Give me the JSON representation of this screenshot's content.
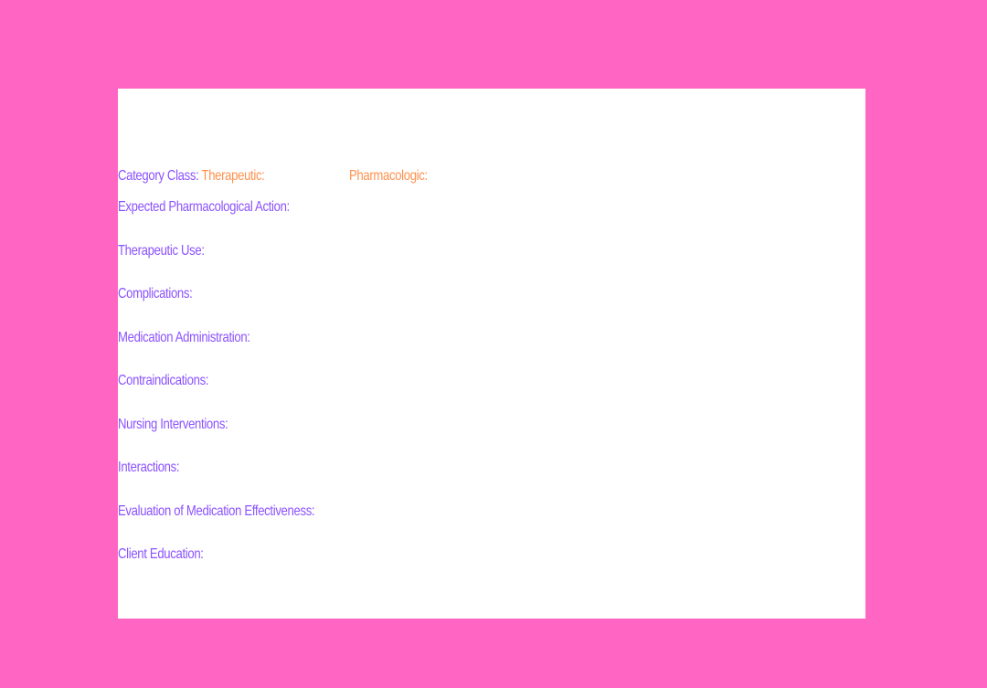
{
  "colors": {
    "background": "#ff66c4",
    "card": "#ffffff",
    "label": "#8c52ff",
    "accent": "#ff914d"
  },
  "category": {
    "label": "Category Class:",
    "therapeutic": "Therapeutic:",
    "pharmacologic": "Pharmacologic:"
  },
  "fields": {
    "expected_action": "Expected Pharmacological Action:",
    "therapeutic_use": "Therapeutic Use:",
    "complications": "Complications:",
    "administration": "Medication Administration:",
    "contraindications": "Contraindications:",
    "nursing_interventions": "Nursing Interventions:",
    "interactions": "Interactions:",
    "evaluation": "Evaluation of Medication Effectiveness:",
    "client_education": "Client Education:"
  }
}
